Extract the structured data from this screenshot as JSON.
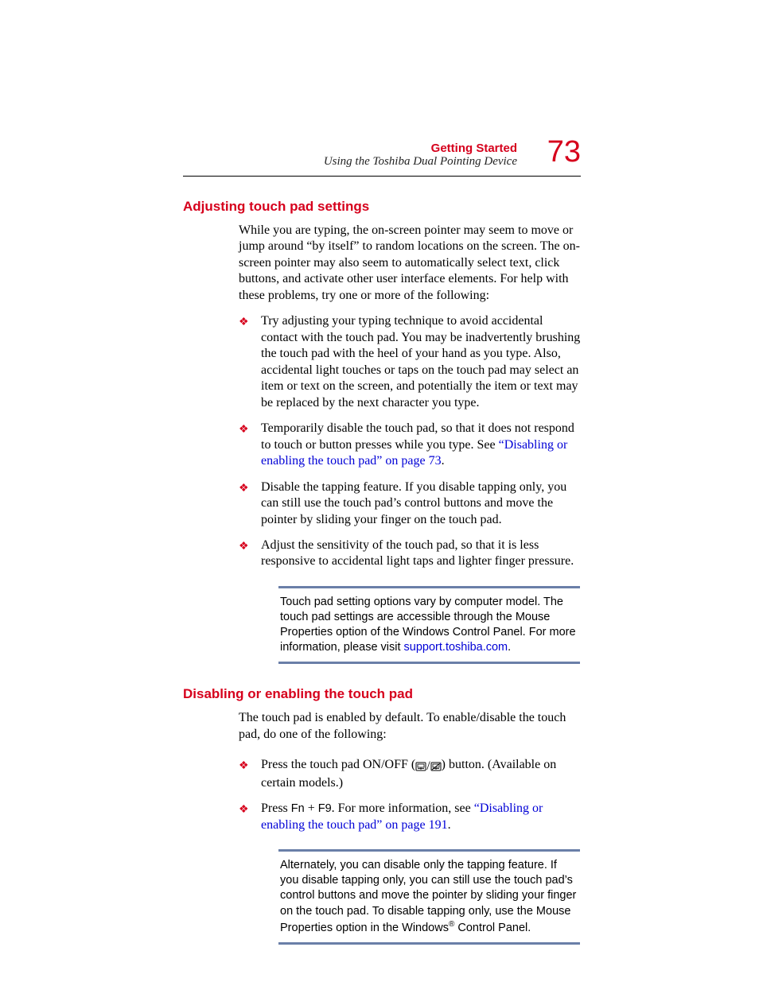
{
  "header": {
    "chapter": "Getting Started",
    "section": "Using the Toshiba Dual Pointing Device",
    "page_number": "73"
  },
  "section1": {
    "heading": "Adjusting touch pad settings",
    "intro": "While you are typing, the on-screen pointer may seem to move or jump around “by itself” to random locations on the screen. The on-screen pointer may also seem to automatically select text, click buttons, and activate other user interface elements. For help with these problems, try one or more of the following:",
    "bullets": [
      {
        "text": "Try adjusting your typing technique to avoid accidental contact with the touch pad. You may be inadvertently brushing the touch pad with the heel of your hand as you type. Also, accidental light touches or taps on the touch pad may select an item or text on the screen, and potentially the item or text may be replaced by the next character you type."
      },
      {
        "pre": "Temporarily disable the touch pad, so that it does not respond to touch or button presses while you type. See ",
        "link": "“Disabling or enabling the touch pad” on page 73",
        "post": "."
      },
      {
        "text": "Disable the tapping feature. If you disable tapping only, you can still use the touch pad’s control buttons and move the pointer by sliding your finger on the touch pad."
      },
      {
        "text": "Adjust the sensitivity of the touch pad, so that it is less responsive to accidental light taps and lighter finger pressure."
      }
    ],
    "note_pre": "Touch pad setting options vary by computer model. The touch pad settings are accessible through the Mouse Properties option of the Windows Control Panel. For more information, please visit ",
    "note_link": "support.toshiba.com",
    "note_post": "."
  },
  "section2": {
    "heading": "Disabling or enabling the touch pad",
    "intro": "The touch pad is enabled by default. To enable/disable the touch pad, do one of the following:",
    "bullet1_pre": "Press the touch pad ON/OFF (",
    "bullet1_post": ") button. (Available on certain models.)",
    "bullet2_pre": "Press ",
    "bullet2_key1": "Fn",
    "bullet2_plus": " + ",
    "bullet2_key2": "F9",
    "bullet2_mid": ". For more information, see ",
    "bullet2_link": "“Disabling or enabling the touch pad” on page 191",
    "bullet2_post": ".",
    "note_pre": "Alternately, you can disable only the tapping feature. If you disable tapping only, you can still use the touch pad’s control buttons and move the pointer by sliding your finger on the touch pad. To disable tapping only, use the Mouse Properties option in the Windows",
    "note_reg": "®",
    "note_post": " Control Panel."
  }
}
